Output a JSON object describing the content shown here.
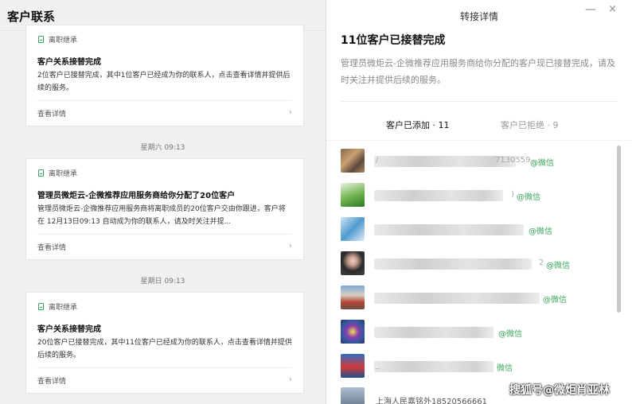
{
  "left": {
    "title": "客户联系",
    "cards": [
      {
        "tag": "离职继承",
        "title": "客户关系接替完成",
        "body": "2位客户已接替完成，其中1位客户已经成为你的联系人，点击查看详情并提供后续的服务。",
        "link": "查看详情"
      },
      {
        "timestamp": "星期六 09:13",
        "tag": "离职继承",
        "title": "管理员微炬云-企微推荐应用服务商给你分配了20位客户",
        "body": "管理员微炬云-企微推荐应用服务商将离职成员的20位客户交由你跟进，客户将在 12月13日09:13 自动成为你的联系人，请及时关注并提...",
        "link": "查看详情"
      },
      {
        "timestamp": "星期日 09:13",
        "tag": "离职继承",
        "title": "客户关系接替完成",
        "body": "20位客户已接替完成，其中11位客户已经成为你的联系人，点击查看详情并提供后续的服务。",
        "link": "查看详情"
      }
    ]
  },
  "right": {
    "title": "转接详情",
    "heading": "11位客户已接替完成",
    "description": "管理员微炬云-企微推荐应用服务商给你分配的客户现已接替完成，请及时关注并提供后续的服务。",
    "tabs": [
      {
        "label": "客户已添加 · 11",
        "active": true
      },
      {
        "label": "客户已拒绝 · 9",
        "active": false
      }
    ],
    "members": [
      {
        "name": "/",
        "name_tail": "7130559",
        "suffix": "@微信"
      },
      {
        "name": "",
        "name_tail": ")",
        "suffix": "@微信"
      },
      {
        "name": "",
        "name_tail": "",
        "suffix": "@微信"
      },
      {
        "name": "",
        "name_tail": "2",
        "suffix": "@微信"
      },
      {
        "name": "",
        "name_tail": "",
        "suffix": "@微信"
      },
      {
        "name": "",
        "name_tail": "",
        "suffix": "@微信"
      },
      {
        "name": "_",
        "name_tail": "",
        "suffix": "微信"
      },
      {
        "name": "上海人民嘉铭外18520566661",
        "name_tail": "",
        "suffix": ""
      }
    ],
    "window_controls": {
      "minimize": "—",
      "close": "×"
    }
  },
  "watermark": "搜狐号@微炬肖亚林",
  "colors": {
    "accent": "#3aa55a",
    "left_bg": "#f0f0f0"
  }
}
